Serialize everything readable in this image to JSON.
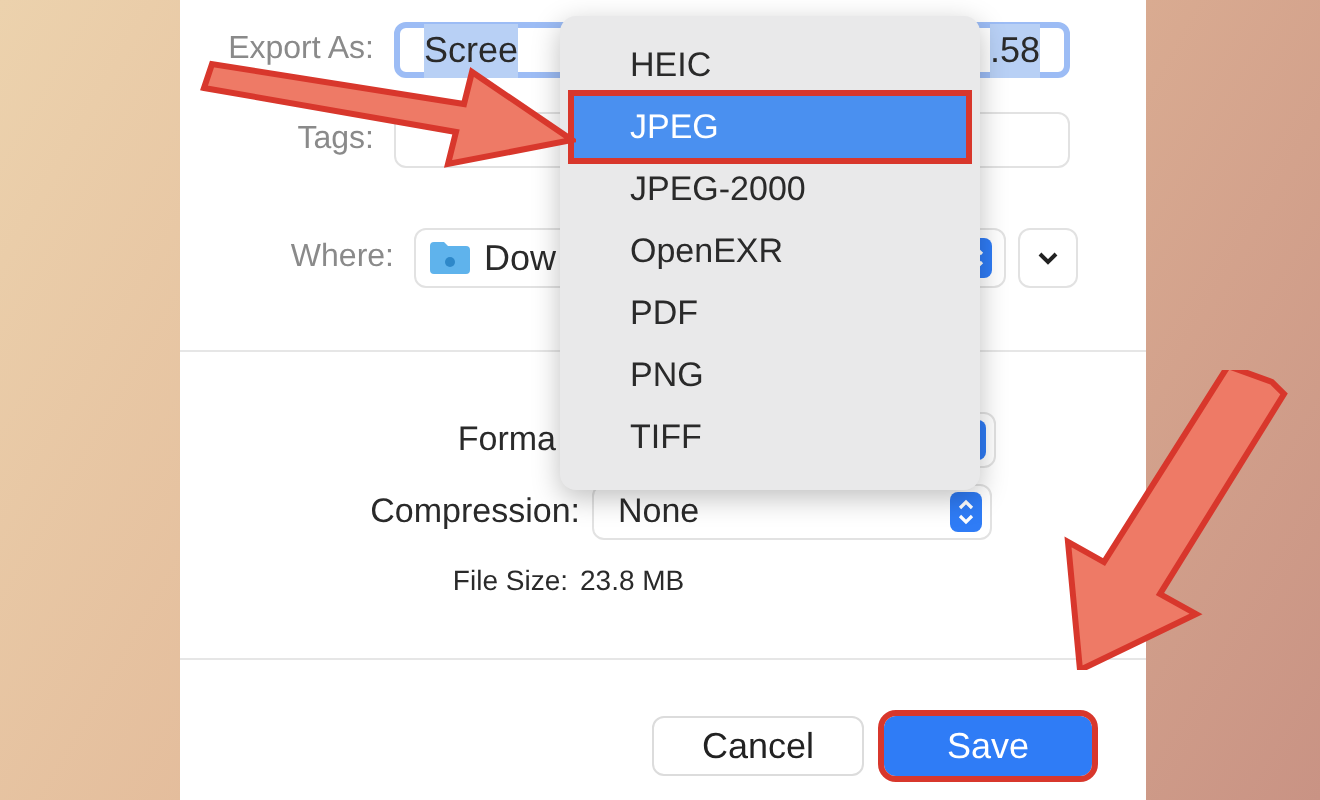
{
  "export_as": {
    "label": "Export As:",
    "value_start": "Scree",
    "value_end": ".58"
  },
  "tags": {
    "label": "Tags:"
  },
  "where": {
    "label": "Where:",
    "value": "Dow"
  },
  "format": {
    "label": "Forma"
  },
  "compression": {
    "label": "Compression:",
    "value": "None"
  },
  "file_size": {
    "label": "File Size:",
    "value": "23.8 MB"
  },
  "format_menu": {
    "items": [
      {
        "label": "HEIC",
        "selected": false,
        "highlighted": false
      },
      {
        "label": "JPEG",
        "selected": true,
        "highlighted": true
      },
      {
        "label": "JPEG-2000",
        "selected": false,
        "highlighted": false
      },
      {
        "label": "OpenEXR",
        "selected": false,
        "highlighted": false
      },
      {
        "label": "PDF",
        "selected": false,
        "highlighted": false
      },
      {
        "label": "PNG",
        "selected": false,
        "highlighted": false
      },
      {
        "label": "TIFF",
        "selected": false,
        "highlighted": false
      }
    ]
  },
  "buttons": [
    {
      "label": "Cancel",
      "kind": "secondary",
      "highlighted": false
    },
    {
      "label": "Save",
      "kind": "primary",
      "highlighted": true
    }
  ]
}
